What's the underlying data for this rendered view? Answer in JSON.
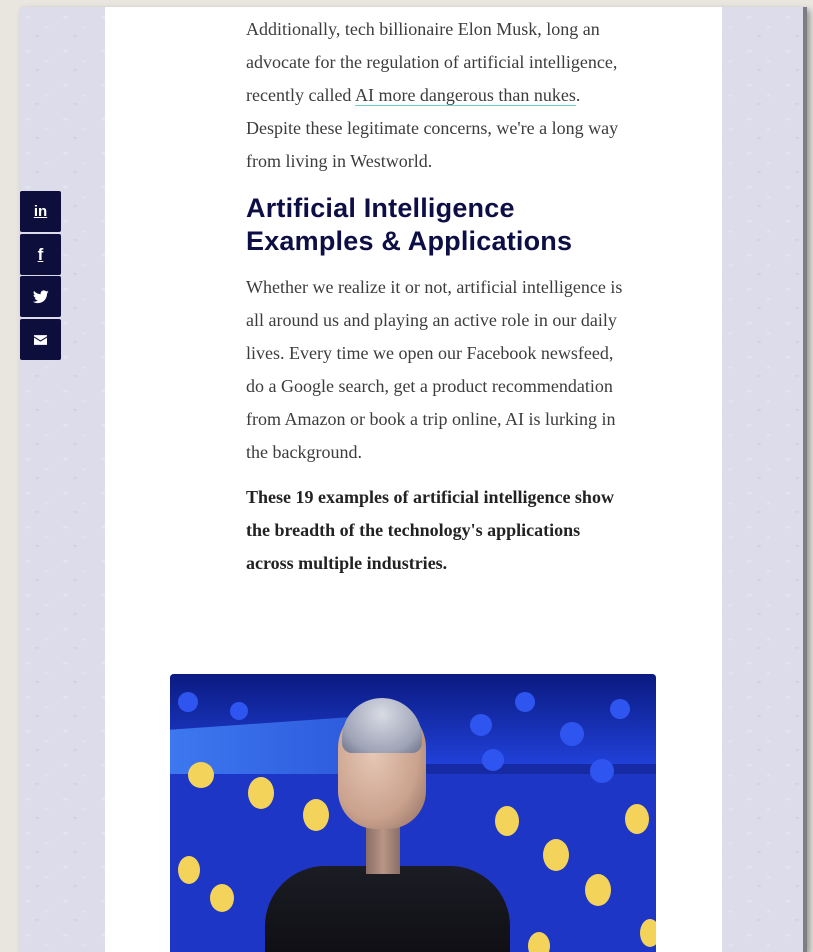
{
  "article": {
    "para1_before_link": "Additionally, tech billionaire Elon Musk, long an advocate for the regulation of artificial intelligence, recently called ",
    "para1_link": "AI more dangerous than nukes",
    "para1_after_link": ". Despite these legitimate concerns, we're a long way from living in Westworld.",
    "heading": "Artificial Intelligence Examples & Applications",
    "para2": "Whether we realize it or not, artificial intelligence is all around us and playing an active role in our daily lives. Every time we open our Facebook newsfeed, do a Google search, get a product recommendation from Amazon or book a trip online, AI is lurking in the background.",
    "para3": "These 19 examples of artificial intelligence show the breadth of the technology's applications across multiple industries."
  },
  "social_share": {
    "items": [
      {
        "icon": "linkedin-icon",
        "glyph": "in"
      },
      {
        "icon": "facebook-icon",
        "glyph": "f"
      },
      {
        "icon": "twitter-icon",
        "glyph": ""
      },
      {
        "icon": "email-icon",
        "glyph": ""
      }
    ]
  },
  "colors": {
    "heading": "#0d0e45",
    "link_underline": "#6fd1cf",
    "social_bg": "#0e0e3c",
    "photo_blue": "#1e36c6",
    "photo_dots": "#f4d35a"
  }
}
